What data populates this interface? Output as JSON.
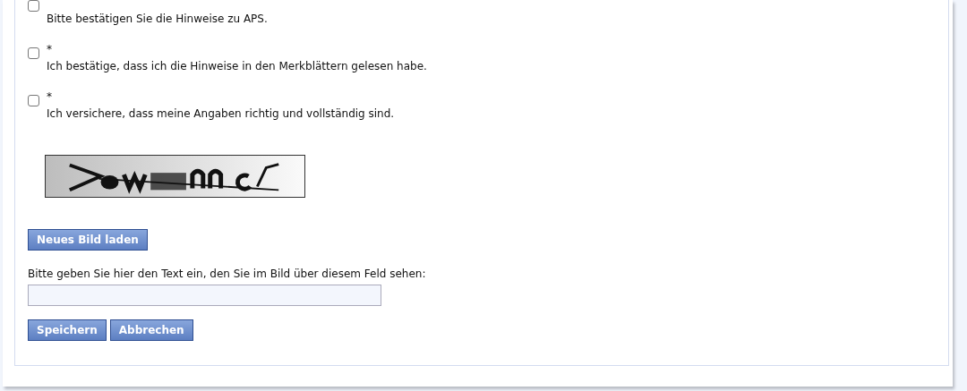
{
  "confirmations": [
    {
      "label": "Bitte bestätigen Sie die Hinweise zu APS.",
      "checked": false
    },
    {
      "marker": "*",
      "label": "Ich bestätige, dass ich die Hinweise in den Merkblättern gelesen habe.",
      "checked": false
    },
    {
      "marker": "*",
      "label": "Ich versichere, dass meine Angaben richtig und vollständig sind.",
      "checked": false
    }
  ],
  "captcha": {
    "kind": "picture",
    "reload_button": "Neues Bild laden"
  },
  "captcha_field": {
    "label": "Bitte geben Sie hier den Text ein, den Sie im Bild über diesem Feld sehen:"
  },
  "buttons": [
    "Speichern",
    "Abbrechen"
  ]
}
